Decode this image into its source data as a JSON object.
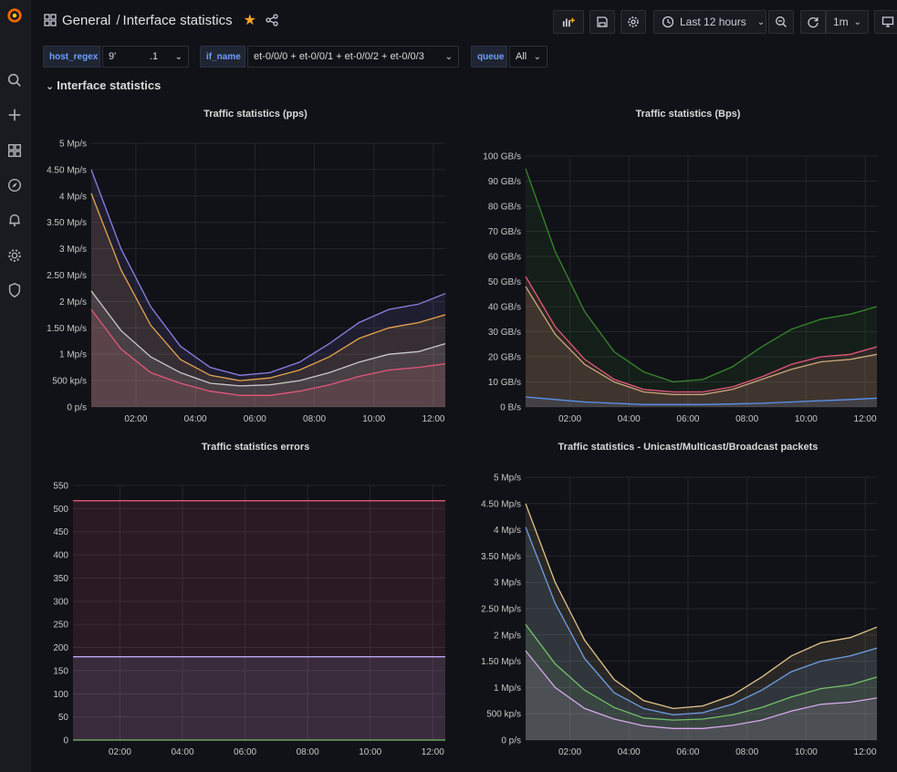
{
  "header": {
    "folder": "General",
    "separator": "/",
    "dashboard": "Interface statistics",
    "time_range": "Last 12 hours",
    "refresh": "1m"
  },
  "variables": [
    {
      "label": "host_regex",
      "value": "9'            .1"
    },
    {
      "label": "if_name",
      "value": "et-0/0/0 + et-0/0/1 + et-0/0/2 + et-0/0/3"
    },
    {
      "label": "queue",
      "value": "All"
    }
  ],
  "row_title": "Interface statistics",
  "icons": [
    "grafana-logo-icon",
    "search-icon",
    "plus-icon",
    "dashboards-icon",
    "explore-icon",
    "alert-bell-icon",
    "settings-gear-icon",
    "shield-icon",
    "add-panel-icon",
    "save-icon",
    "settings-icon",
    "clock-icon",
    "zoom-out-icon",
    "refresh-icon",
    "tv-icon",
    "star-icon",
    "share-icon"
  ],
  "colors": {
    "accent": "#f5a623",
    "var_label": "#6e9fff"
  },
  "chart_data": [
    {
      "type": "area",
      "title": "Traffic statistics (pps)",
      "x_ticks": [
        "02:00",
        "04:00",
        "06:00",
        "08:00",
        "10:00",
        "12:00"
      ],
      "y_ticks": [
        "0 p/s",
        "500 kp/s",
        "1 Mp/s",
        "1.50 Mp/s",
        "2 Mp/s",
        "2.50 Mp/s",
        "3 Mp/s",
        "3.50 Mp/s",
        "4 Mp/s",
        "4.50 Mp/s",
        "5 Mp/s"
      ],
      "ylim": [
        0,
        5
      ],
      "x_hours": [
        0.5,
        1.5,
        2.5,
        3.5,
        4.5,
        5.5,
        6.5,
        7.5,
        8.5,
        9.5,
        10.5,
        11.5,
        12.4
      ],
      "series": [
        {
          "color": "#8f7fe3",
          "values": [
            4.5,
            3.0,
            1.9,
            1.15,
            0.75,
            0.6,
            0.65,
            0.85,
            1.2,
            1.6,
            1.85,
            1.95,
            2.15
          ]
        },
        {
          "color": "#e5a54b",
          "values": [
            4.05,
            2.6,
            1.55,
            0.9,
            0.6,
            0.5,
            0.55,
            0.7,
            0.95,
            1.3,
            1.5,
            1.6,
            1.75
          ]
        },
        {
          "color": "#c8c8c8",
          "values": [
            2.2,
            1.45,
            0.95,
            0.65,
            0.45,
            0.4,
            0.42,
            0.5,
            0.65,
            0.85,
            1.0,
            1.05,
            1.2
          ]
        },
        {
          "color": "#e3577a",
          "values": [
            1.85,
            1.1,
            0.65,
            0.45,
            0.3,
            0.22,
            0.22,
            0.3,
            0.42,
            0.58,
            0.7,
            0.75,
            0.82
          ]
        }
      ]
    },
    {
      "type": "area",
      "title": "Traffic statistics (Bps)",
      "x_ticks": [
        "02:00",
        "04:00",
        "06:00",
        "08:00",
        "10:00",
        "12:00"
      ],
      "y_ticks": [
        "0 B/s",
        "10 GB/s",
        "20 GB/s",
        "30 GB/s",
        "40 GB/s",
        "50 GB/s",
        "60 GB/s",
        "70 GB/s",
        "80 GB/s",
        "90 GB/s",
        "100 GB/s"
      ],
      "ylim": [
        0,
        100
      ],
      "x_hours": [
        0.5,
        1.5,
        2.5,
        3.5,
        4.5,
        5.5,
        6.5,
        7.5,
        8.5,
        9.5,
        10.5,
        11.5,
        12.4
      ],
      "series": [
        {
          "color": "#37872d",
          "values": [
            95,
            62,
            38,
            22,
            14,
            10,
            11,
            16,
            24,
            31,
            35,
            37,
            40
          ]
        },
        {
          "color": "#e3577a",
          "values": [
            52,
            32,
            19,
            11,
            7,
            6,
            6,
            8,
            12,
            17,
            20,
            21,
            24
          ]
        },
        {
          "color": "#c9a77a",
          "values": [
            48,
            29,
            17,
            10,
            6,
            5,
            5,
            7,
            11,
            15,
            18,
            19,
            21
          ]
        },
        {
          "color": "#5794f2",
          "values": [
            4,
            3,
            2,
            1.5,
            1,
            1,
            1,
            1.2,
            1.5,
            2,
            2.5,
            3,
            3.5
          ]
        }
      ]
    },
    {
      "type": "area",
      "title": "Traffic statistics errors",
      "x_ticks": [
        "02:00",
        "04:00",
        "06:00",
        "08:00",
        "10:00",
        "12:00"
      ],
      "y_ticks": [
        "0",
        "50",
        "100",
        "150",
        "200",
        "250",
        "300",
        "350",
        "400",
        "450",
        "500",
        "550"
      ],
      "ylim": [
        0,
        550
      ],
      "x_hours": [
        0.5,
        12.4
      ],
      "series": [
        {
          "color": "#e3577a",
          "values": [
            517,
            517
          ]
        },
        {
          "color": "#b7a9f5",
          "values": [
            180,
            180
          ]
        },
        {
          "color": "#73bf69",
          "values": [
            0,
            0
          ]
        }
      ]
    },
    {
      "type": "area",
      "title": "Traffic statistics - Unicast/Multicast/Broadcast packets",
      "x_ticks": [
        "02:00",
        "04:00",
        "06:00",
        "08:00",
        "10:00",
        "12:00"
      ],
      "y_ticks": [
        "0 p/s",
        "500 kp/s",
        "1 Mp/s",
        "1.50 Mp/s",
        "2 Mp/s",
        "2.50 Mp/s",
        "3 Mp/s",
        "3.50 Mp/s",
        "4 Mp/s",
        "4.50 Mp/s",
        "5 Mp/s"
      ],
      "ylim": [
        0,
        5
      ],
      "x_hours": [
        0.5,
        1.5,
        2.5,
        3.5,
        4.5,
        5.5,
        6.5,
        7.5,
        8.5,
        9.5,
        10.5,
        11.5,
        12.4
      ],
      "series": [
        {
          "color": "#e0c58b",
          "values": [
            4.5,
            3.0,
            1.9,
            1.15,
            0.75,
            0.6,
            0.65,
            0.85,
            1.2,
            1.6,
            1.85,
            1.95,
            2.15
          ]
        },
        {
          "color": "#6e9fe6",
          "values": [
            4.05,
            2.6,
            1.55,
            0.9,
            0.6,
            0.48,
            0.52,
            0.68,
            0.95,
            1.3,
            1.5,
            1.6,
            1.75
          ]
        },
        {
          "color": "#73bf69",
          "values": [
            2.2,
            1.45,
            0.95,
            0.62,
            0.42,
            0.38,
            0.4,
            0.48,
            0.62,
            0.82,
            0.98,
            1.05,
            1.2
          ]
        },
        {
          "color": "#d6a8e8",
          "values": [
            1.7,
            1.0,
            0.6,
            0.4,
            0.27,
            0.22,
            0.22,
            0.28,
            0.38,
            0.55,
            0.68,
            0.72,
            0.8
          ]
        }
      ]
    }
  ]
}
